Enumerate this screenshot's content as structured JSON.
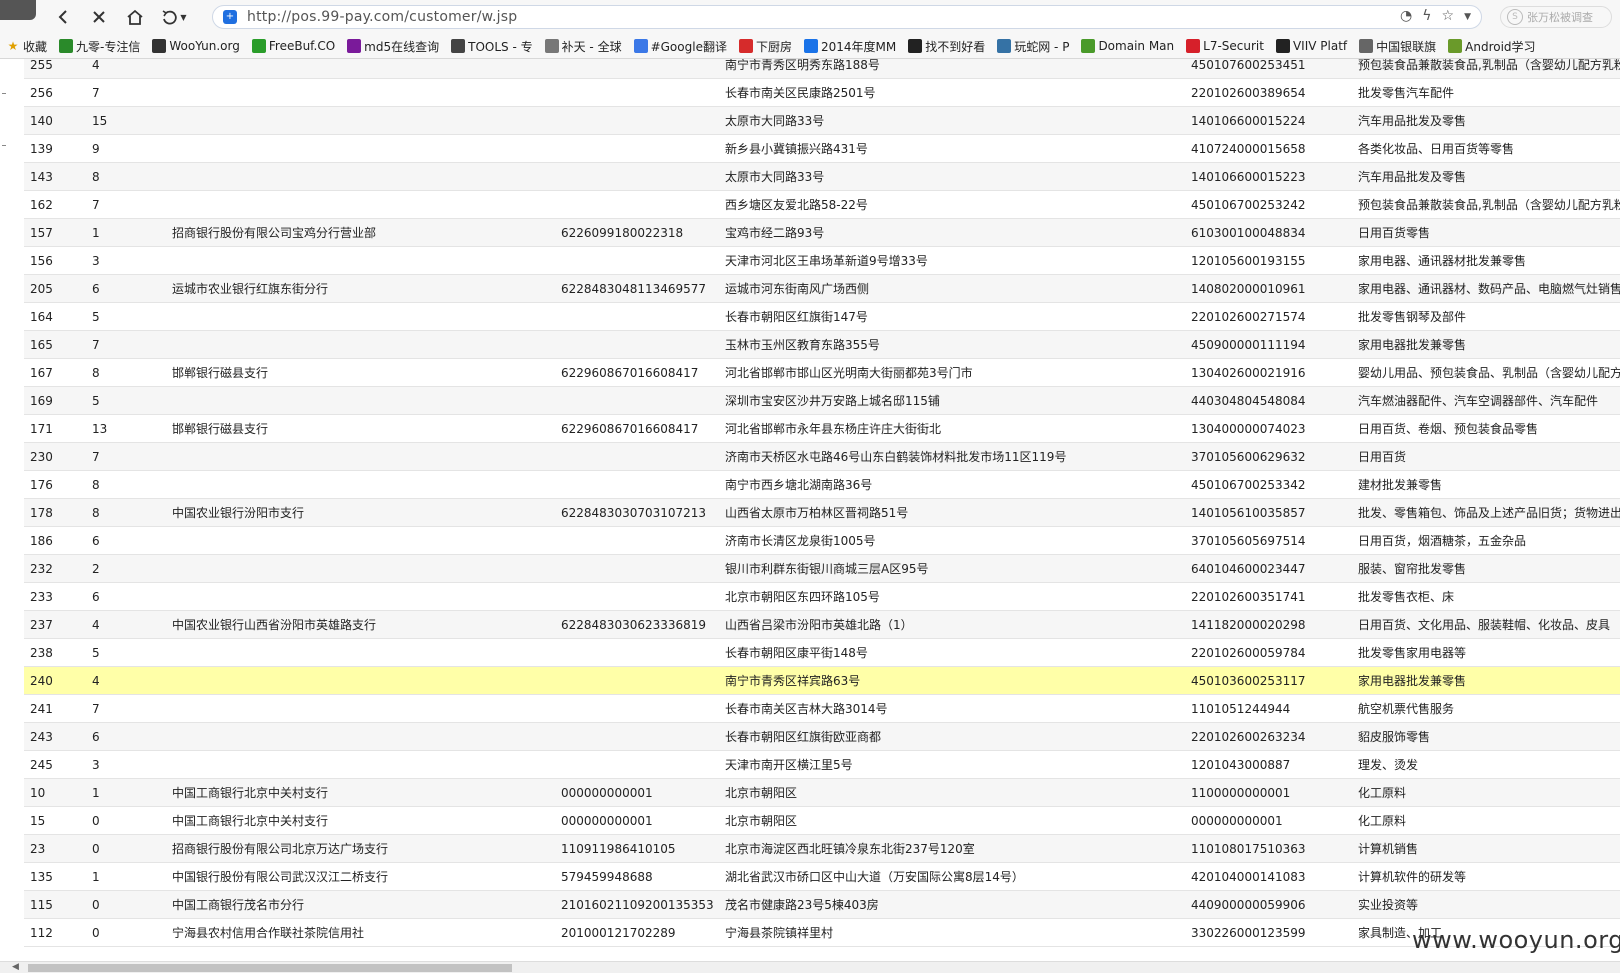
{
  "browser": {
    "url": "http://pos.99-pay.com/customer/w.jsp",
    "user_label": "张万松被调查"
  },
  "bookmarks": [
    {
      "label": "收藏",
      "icon": "star-icon",
      "color": "#e0a000"
    },
    {
      "label": "九零-专注信",
      "icon": "leaf-icon",
      "color": "#2a8a2a"
    },
    {
      "label": "WooYun.org",
      "icon": "wooyun-icon",
      "color": "#333333"
    },
    {
      "label": "FreeBuf.CO",
      "icon": "freebuf-icon",
      "color": "#2a9d2a"
    },
    {
      "label": "md5在线查询",
      "icon": "grid-icon",
      "color": "#7a1a9a"
    },
    {
      "label": "TOOLS - 专",
      "icon": "tools-icon",
      "color": "#444444"
    },
    {
      "label": "补天 - 全球",
      "icon": "butian-icon",
      "color": "#777777"
    },
    {
      "label": "#Google翻译",
      "icon": "translate-icon",
      "color": "#3b78e7"
    },
    {
      "label": "下厨房",
      "icon": "kitchen-icon",
      "color": "#d62b2b"
    },
    {
      "label": "2014年度MM",
      "icon": "play-icon",
      "color": "#1a73e8"
    },
    {
      "label": "找不到好看",
      "icon": "w-icon",
      "color": "#222222"
    },
    {
      "label": "玩蛇网 - P",
      "icon": "python-icon",
      "color": "#3572a5"
    },
    {
      "label": "Domain Man",
      "icon": "domain-icon",
      "color": "#4a9a2a"
    },
    {
      "label": "L7-Securit",
      "icon": "l7-icon",
      "color": "#d6202a"
    },
    {
      "label": "VIIV Platf",
      "icon": "code-icon",
      "color": "#222222"
    },
    {
      "label": "中国银联旗",
      "icon": "page-icon",
      "color": "#666666"
    },
    {
      "label": "Android学习",
      "icon": "android-icon",
      "color": "#6a9a2a"
    }
  ],
  "table": {
    "rows": [
      [
        "255",
        "4",
        "",
        "",
        "南宁市青秀区明秀东路188号",
        "450107600253451",
        "预包装食品兼散装食品,乳制品（含婴幼儿配方乳粉）"
      ],
      [
        "256",
        "7",
        "",
        "",
        "长春市南关区民康路2501号",
        "220102600389654",
        "批发零售汽车配件"
      ],
      [
        "140",
        "15",
        "",
        "",
        "太原市大同路33号",
        "140106600015224",
        "汽车用品批发及零售"
      ],
      [
        "139",
        "9",
        "",
        "",
        "新乡县小冀镇振兴路431号",
        "410724000015658",
        "各类化妆品、日用百货等零售"
      ],
      [
        "143",
        "8",
        "",
        "",
        "太原市大同路33号",
        "140106600015223",
        "汽车用品批发及零售"
      ],
      [
        "162",
        "7",
        "",
        "",
        "西乡塘区友爱北路58-22号",
        "450106700253242",
        "预包装食品兼散装食品,乳制品（含婴幼儿配方乳粉）"
      ],
      [
        "157",
        "1",
        "招商银行股份有限公司宝鸡分行营业部",
        "6226099180022318",
        "宝鸡市经二路93号",
        "610300100048834",
        "日用百货零售"
      ],
      [
        "156",
        "3",
        "",
        "",
        "天津市河北区王串场革新道9号增33号",
        "120105600193155",
        "家用电器、通讯器材批发兼零售"
      ],
      [
        "205",
        "6",
        "运城市农业银行红旗东街分行",
        "6228483048113469577",
        "运城市河东街南风广场西侧",
        "140802000010961",
        "家用电器、通讯器材、数码产品、电脑燃气灶销售"
      ],
      [
        "164",
        "5",
        "",
        "",
        "长春市朝阳区红旗街147号",
        "220102600271574",
        "批发零售钢琴及部件"
      ],
      [
        "165",
        "7",
        "",
        "",
        "玉林市玉州区教育东路355号",
        "450900000111194",
        "家用电器批发兼零售"
      ],
      [
        "167",
        "8",
        "邯郸银行磁县支行",
        "622960867016608417",
        "河北省邯郸市邯山区光明南大街丽都苑3号门市",
        "130402600021916",
        "婴幼儿用品、预包装食品、乳制品（含婴幼儿配方乳粉）"
      ],
      [
        "169",
        "5",
        "",
        "",
        "深圳市宝安区沙井万安路上城名邸115铺",
        "440304804548084",
        "汽车燃油器配件、汽车空调器部件、汽车配件"
      ],
      [
        "171",
        "13",
        "邯郸银行磁县支行",
        "622960867016608417",
        "河北省邯郸市永年县东杨庄许庄大街街北",
        "130400000074023",
        "日用百货、卷烟、预包装食品零售"
      ],
      [
        "230",
        "7",
        "",
        "",
        "济南市天桥区水屯路46号山东白鹤装饰材料批发市场11区119号",
        "370105600629632",
        "日用百货"
      ],
      [
        "176",
        "8",
        "",
        "",
        "南宁市西乡塘北湖南路36号",
        "450106700253342",
        "建材批发兼零售"
      ],
      [
        "178",
        "8",
        "中国农业银行汾阳市支行",
        "6228483030703107213",
        "山西省太原市万柏林区晋祠路51号",
        "140105610035857",
        "批发、零售箱包、饰品及上述产品旧货；货物进出口"
      ],
      [
        "186",
        "6",
        "",
        "",
        "济南市长清区龙泉街1005号",
        "370105605697514",
        "日用百货，烟酒糖茶，五金杂品"
      ],
      [
        "232",
        "2",
        "",
        "",
        "银川市利群东街银川商城三层A区95号",
        "640104600023447",
        "服装、窗帘批发零售"
      ],
      [
        "233",
        "6",
        "",
        "",
        "北京市朝阳区东四环路105号",
        "220102600351741",
        "批发零售衣柜、床"
      ],
      [
        "237",
        "4",
        "中国农业银行山西省汾阳市英雄路支行",
        "6228483030623336819",
        "山西省吕梁市汾阳市英雄北路（1）",
        "141182000020298",
        "日用百货、文化用品、服装鞋帽、化妆品、皮具"
      ],
      [
        "238",
        "5",
        "",
        "",
        "长春市朝阳区康平街148号",
        "220102600059784",
        "批发零售家用电器等"
      ],
      [
        "240",
        "4",
        "",
        "",
        "南宁市青秀区祥宾路63号",
        "450103600253117",
        "家用电器批发兼零售"
      ],
      [
        "241",
        "7",
        "",
        "",
        "长春市南关区吉林大路3014号",
        "110105124494​4",
        "航空机票代售服务"
      ],
      [
        "243",
        "6",
        "",
        "",
        "长春市朝阳区红旗街欧亚商都",
        "220102600263234",
        "貂皮服饰零售"
      ],
      [
        "245",
        "3",
        "",
        "",
        "天津市南开区横江里5号",
        "120104300088​7",
        "理发、烫发"
      ],
      [
        "10",
        "1",
        "中国工商银行北京中关村支行",
        "000000000001",
        "北京市朝阳区",
        "110000000000​1",
        "化工原料"
      ],
      [
        "15",
        "0",
        "中国工商银行北京中关村支行",
        "000000000001",
        "北京市朝阳区",
        "000000000001",
        "化工原料"
      ],
      [
        "23",
        "0",
        "招商银行股份有限公司北京万达广场支行",
        "110911986410105",
        "北京市海淀区西北旺镇冷泉东北街237号120室",
        "110108017510363",
        "计算机销售"
      ],
      [
        "135",
        "1",
        "中国银行股份有限公司武汉汉江二桥支行",
        "579459948688",
        "湖北省武汉市硚口区中山大道（万安国际公寓8层14号）",
        "420104000141083",
        "计算机软件的研发等"
      ],
      [
        "115",
        "0",
        "中国工商银行茂名市分行",
        "21016021109200135353",
        "茂名市健康路23号5楝403房",
        "440900000059906",
        "实业投资等"
      ],
      [
        "112",
        "0",
        "宁海县农村信用合作联社茶院信用社",
        "201000121702289",
        "宁海县茶院镇祥里村",
        "330226000123599",
        "家具制造、加工"
      ]
    ],
    "highlight_row_key": "240",
    "highlight_color": "#ffffa8"
  },
  "watermark": "www.wooyun.org"
}
